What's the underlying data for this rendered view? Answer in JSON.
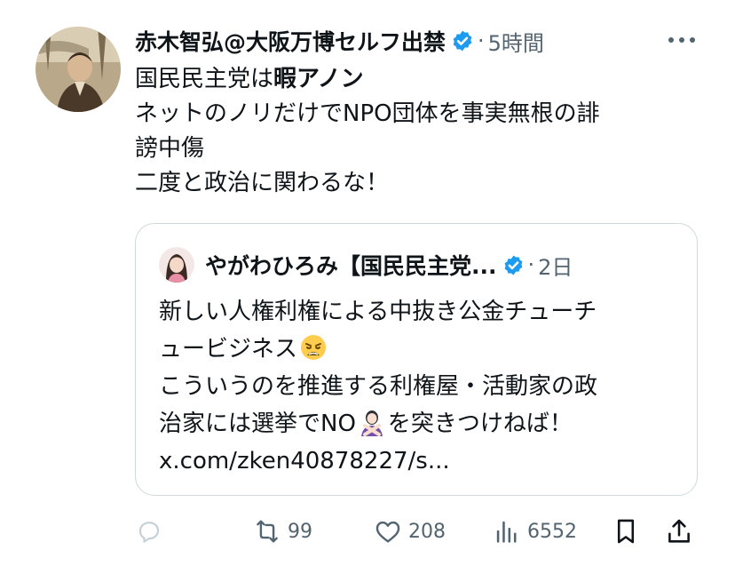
{
  "tweet": {
    "author_name": "赤木智弘@大阪万博セルフ出禁",
    "time_sep": "·",
    "time": "5時間",
    "more_label": "•••",
    "lines": [
      {
        "normal": "国民民主党は",
        "bold": "暇アノン"
      },
      {
        "normal": "ネットのノリだけでNPO団体を事実無根の誹"
      },
      {
        "normal": "謗中傷"
      },
      {
        "normal": "二度と政治に関わるな！"
      }
    ]
  },
  "quote": {
    "author_name": "やがわひろみ【国民民主党...",
    "time_sep": "·",
    "time": "2日",
    "line1": "新しい人権利権による中抜き公金チューチ",
    "line2": "ュービジネス",
    "emoji1": "weary-face-emoji",
    "line3": "こういうのを推進する利権屋・活動家の政",
    "line4a": "治家には選挙でNO",
    "emoji2": "person-gesturing-no-emoji",
    "line4b": "を突きつけねば！",
    "line5": "x.com/zken40878227/s..."
  },
  "actions": {
    "reply": {
      "icon": "reply-icon",
      "count": ""
    },
    "retweet": {
      "icon": "retweet-icon",
      "count": "99"
    },
    "like": {
      "icon": "heart-icon",
      "count": "208"
    },
    "views": {
      "icon": "views-icon",
      "count": "6552"
    },
    "bookmark": {
      "icon": "bookmark-icon"
    },
    "share": {
      "icon": "share-icon"
    }
  },
  "colors": {
    "text": "#0f1419",
    "secondary": "#536471",
    "verified": "#1d9bf0",
    "border": "#cfd9de"
  }
}
